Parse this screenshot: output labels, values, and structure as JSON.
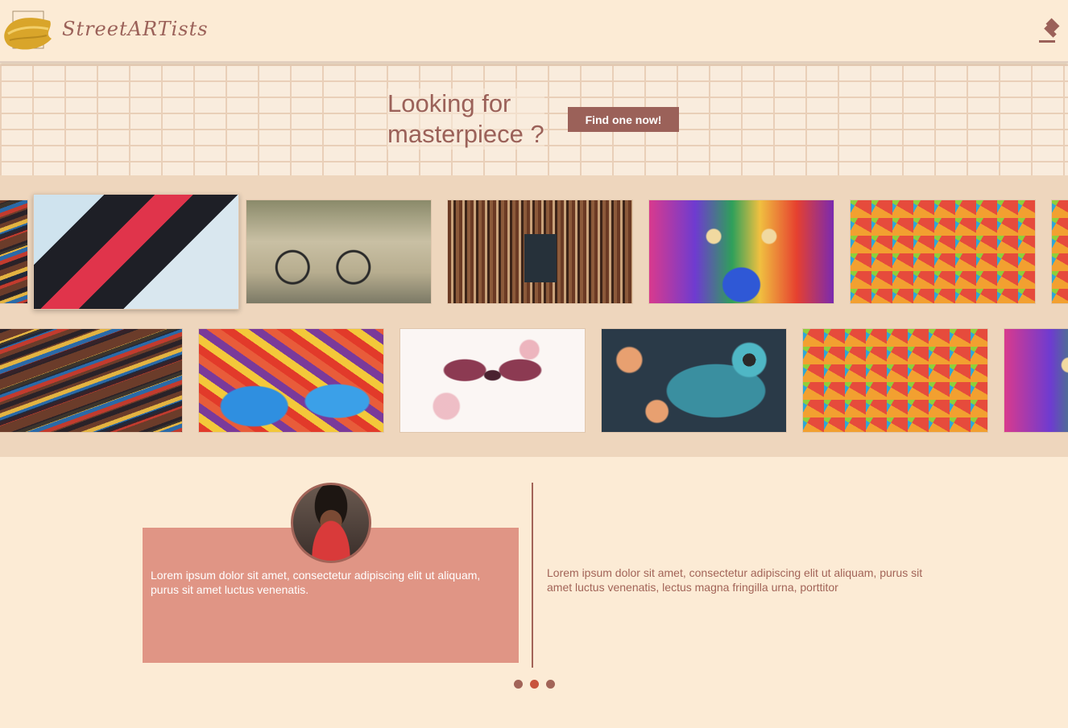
{
  "header": {
    "brand": "StreetARTists",
    "logo_icon": "paint-swatch-logo",
    "action_icon": "gavel-icon"
  },
  "hero": {
    "title": "Looking for masterpiece ?",
    "cta_label": "Find one now!"
  },
  "gallery": {
    "row1": [
      {
        "icon": "paint-brushes-image"
      },
      {
        "icon": "striped-wall-image"
      },
      {
        "icon": "bicycle-mural-image"
      },
      {
        "icon": "book-wall-image"
      },
      {
        "icon": "painted-face-image"
      },
      {
        "icon": "mosaic-tiles-image"
      },
      {
        "icon": "partial-image"
      }
    ],
    "row2": [
      {
        "icon": "paint-brushes-image"
      },
      {
        "icon": "graffiti-image"
      },
      {
        "icon": "moth-painting-image"
      },
      {
        "icon": "fish-art-image"
      },
      {
        "icon": "mosaic-tiles-image"
      },
      {
        "icon": "painted-face-image"
      }
    ]
  },
  "testimonial": {
    "card_text": "Lorem ipsum dolor sit amet, consectetur adipiscing elit ut aliquam, purus sit amet luctus venenatis.",
    "quote_text": "Lorem ipsum dolor sit amet, consectetur adipiscing elit ut aliquam, purus sit amet luctus venenatis, lectus magna fringilla urna, porttitor",
    "active_slide": 2,
    "slide_count": 3
  },
  "colors": {
    "background": "#fcebd5",
    "accent": "#9b6159",
    "card": "#e09585",
    "gallery_band": "#eed6bd"
  }
}
